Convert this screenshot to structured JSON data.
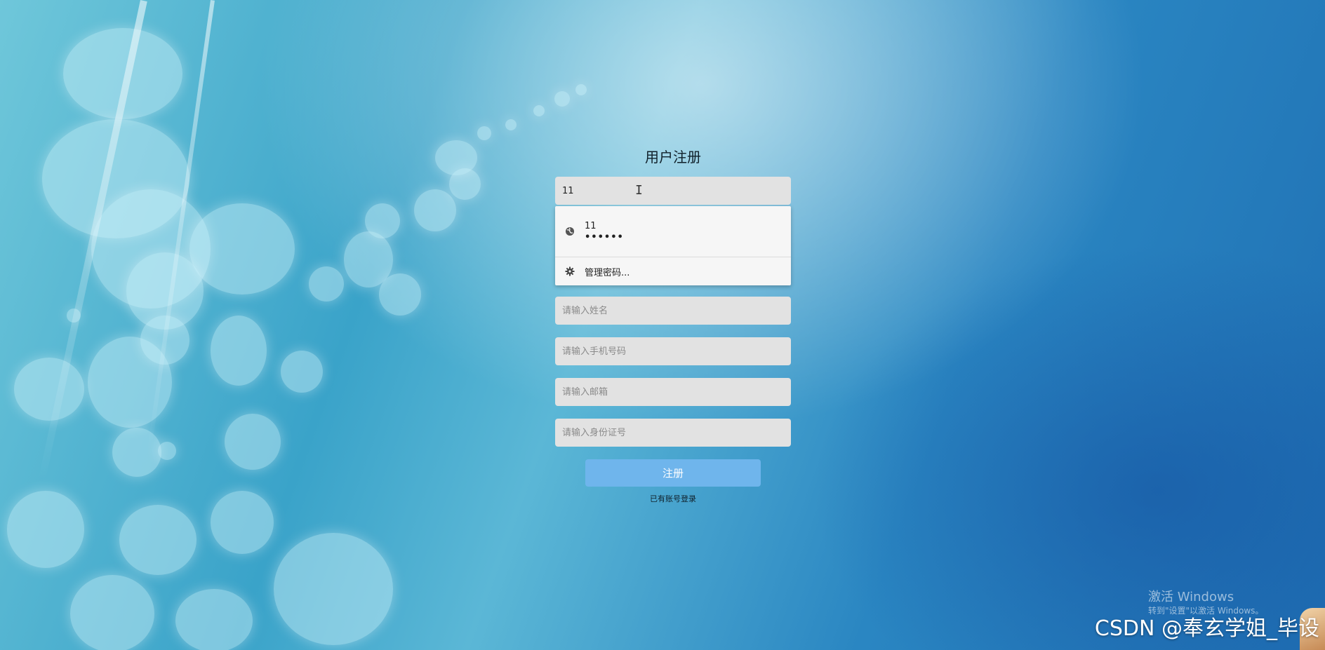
{
  "form": {
    "title": "用户注册",
    "username_value": "11",
    "name_placeholder": "请输入姓名",
    "phone_placeholder": "请输入手机号码",
    "email_placeholder": "请输入邮箱",
    "idcard_placeholder": "请输入身份证号",
    "submit_label": "注册",
    "login_link": "已有账号登录"
  },
  "autofill": {
    "saved_username": "11",
    "saved_password_mask": "••••••",
    "manage_label": "管理密码..."
  },
  "os_overlay": {
    "activate_title": "激活 Windows",
    "activate_sub": "转到\"设置\"以激活 Windows。"
  },
  "watermark": {
    "text": "CSDN @奉玄学姐_毕设"
  },
  "colors": {
    "submit_button": "#6fb5ec",
    "field_background": "#e2e2e2",
    "background_accent": "#2a86c2"
  }
}
